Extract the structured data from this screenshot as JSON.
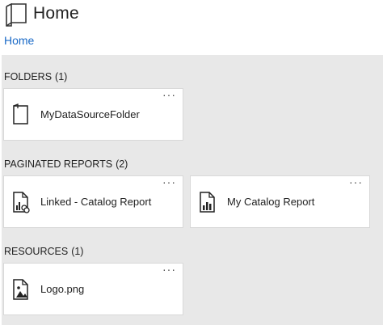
{
  "header": {
    "title": "Home",
    "breadcrumb": "Home"
  },
  "sections": [
    {
      "title": "FOLDERS",
      "count": "(1)",
      "items": [
        {
          "label": "MyDataSourceFolder",
          "icon": "folder-icon"
        }
      ]
    },
    {
      "title": "PAGINATED REPORTS",
      "count": "(2)",
      "items": [
        {
          "label": "Linked - Catalog Report",
          "icon": "linked-report-icon"
        },
        {
          "label": "My Catalog Report",
          "icon": "report-icon"
        }
      ]
    },
    {
      "title": "RESOURCES",
      "count": "(1)",
      "items": [
        {
          "label": "Logo.png",
          "icon": "image-file-icon"
        }
      ]
    }
  ],
  "more_label": "···",
  "colors": {
    "link": "#1a6ac7",
    "panel": "#e8e8e8",
    "tile": "#ffffff"
  }
}
